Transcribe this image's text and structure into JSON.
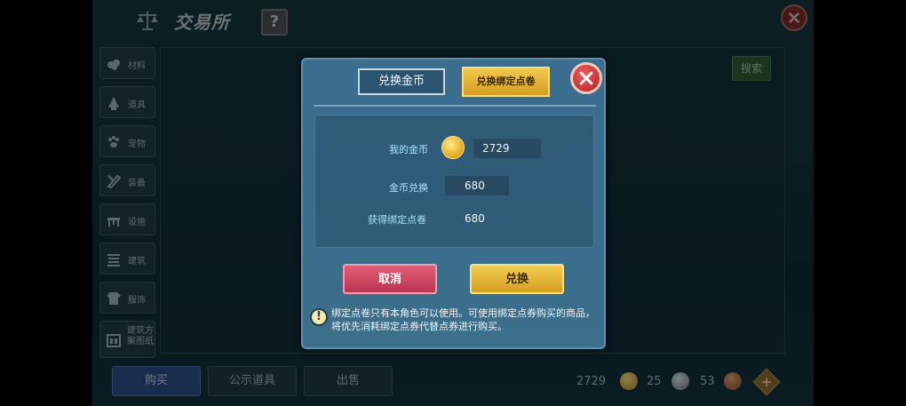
{
  "header": {
    "title": "交易所",
    "help_label": "?"
  },
  "search": {
    "button_label": "搜索"
  },
  "sidebar": {
    "items": [
      {
        "label": "材料",
        "icon": "materials-icon"
      },
      {
        "label": "道具",
        "icon": "props-icon"
      },
      {
        "label": "宠物",
        "icon": "pet-paw-icon"
      },
      {
        "label": "装备",
        "icon": "equipment-icon"
      },
      {
        "label": "设施",
        "icon": "facility-icon"
      },
      {
        "label": "建筑",
        "icon": "building-icon"
      },
      {
        "label": "服饰",
        "icon": "clothing-icon"
      },
      {
        "label": "建筑方案图纸",
        "icon": "blueprint-icon"
      }
    ]
  },
  "bottom": {
    "tabs": [
      "购买",
      "公示道具",
      "出售"
    ],
    "currencies": [
      {
        "amount": "2729",
        "icon": "gold-coin-icon"
      },
      {
        "amount": "25",
        "icon": "silver-coin-icon"
      },
      {
        "amount": "53",
        "icon": "copper-coin-icon"
      }
    ],
    "plus_label": "+"
  },
  "dialog": {
    "tab_gold": "兑换金币",
    "tab_bind": "兑换绑定点卷",
    "my_gold_label": "我的金币",
    "my_gold_value": "2729",
    "exchange_label": "金币兑换",
    "exchange_value": "680",
    "obtain_label": "获得绑定点卷",
    "obtain_value": "680",
    "cancel_label": "取消",
    "confirm_label": "兑换",
    "notice": "绑定点卷只有本角色可以使用。可使用绑定点券购买的商品，将优先消耗绑定点券代替点券进行购买。",
    "warn_symbol": "!"
  },
  "colors": {
    "accent_gold": "#e3b232",
    "cancel_pink": "#d24a67",
    "dialog_blue": "#3a6d8e",
    "label_cyan": "#a8e4ff"
  }
}
